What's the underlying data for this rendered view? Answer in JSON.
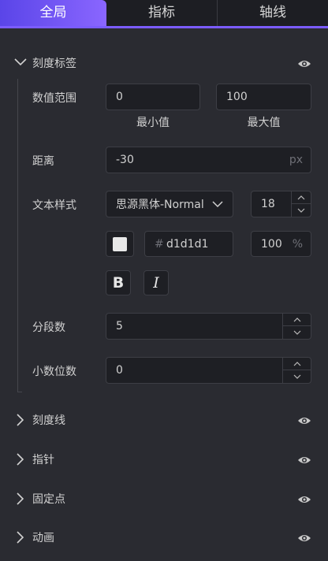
{
  "tabs": [
    {
      "label": "全局"
    },
    {
      "label": "指标"
    },
    {
      "label": "轴线"
    }
  ],
  "sections": {
    "tick_labels": {
      "title": "刻度标签"
    },
    "tick_lines": {
      "title": "刻度线"
    },
    "pointer": {
      "title": "指针"
    },
    "fixed_point": {
      "title": "固定点"
    },
    "animation": {
      "title": "动画"
    }
  },
  "range": {
    "label": "数值范围",
    "min_value": "0",
    "max_value": "100",
    "min_caption": "最小值",
    "max_caption": "最大值"
  },
  "distance": {
    "label": "距离",
    "value": "-30",
    "unit": "px"
  },
  "text_style": {
    "label": "文本样式",
    "font": "思源黑体-Normal",
    "size": "18",
    "color_hash": "#",
    "color_hex": "d1d1d1",
    "opacity": "100",
    "opacity_unit": "%",
    "bold_label": "B",
    "italic_label": "I"
  },
  "segments": {
    "label": "分段数",
    "value": "5"
  },
  "decimals": {
    "label": "小数位数",
    "value": "0"
  },
  "colors": {
    "accent": "#7b5cff",
    "panel": "#2a2b31",
    "input": "#1e1f24",
    "swatch": "#e8e8e8"
  },
  "icons": {
    "expand": "chevron-down-icon",
    "collapse": "chevron-right-icon",
    "visibility": "eye-icon"
  }
}
